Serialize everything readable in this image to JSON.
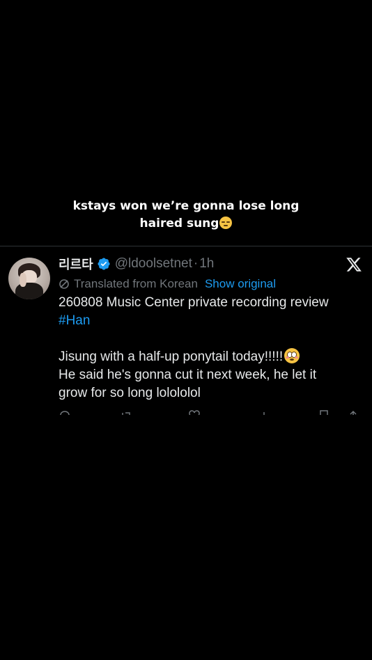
{
  "caption": {
    "line1": "kstays won we’re gonna lose long",
    "line2": "haired sung",
    "emoji": "pensive-face"
  },
  "tweet": {
    "display_name": "리르타",
    "handle": "@ldoolsetnet",
    "separator": "·",
    "time": "1h",
    "verified_color": "#1d9bf0",
    "translated_label": "Translated from Korean",
    "show_original": "Show original",
    "text_line1": "260808 Music Center private recording review",
    "hashtag": "#Han",
    "text_line3": "Jisung with a half-up ponytail today!!!!!",
    "text_line4": "He said he's gonna cut it next week, he let it",
    "text_line5": "grow for so long lolololol",
    "emoji": "flushed-face"
  },
  "colors": {
    "background": "#000000",
    "text": "#e7e9ea",
    "muted": "#71767b",
    "accent": "#1d9bf0",
    "divider": "#2f3336"
  }
}
